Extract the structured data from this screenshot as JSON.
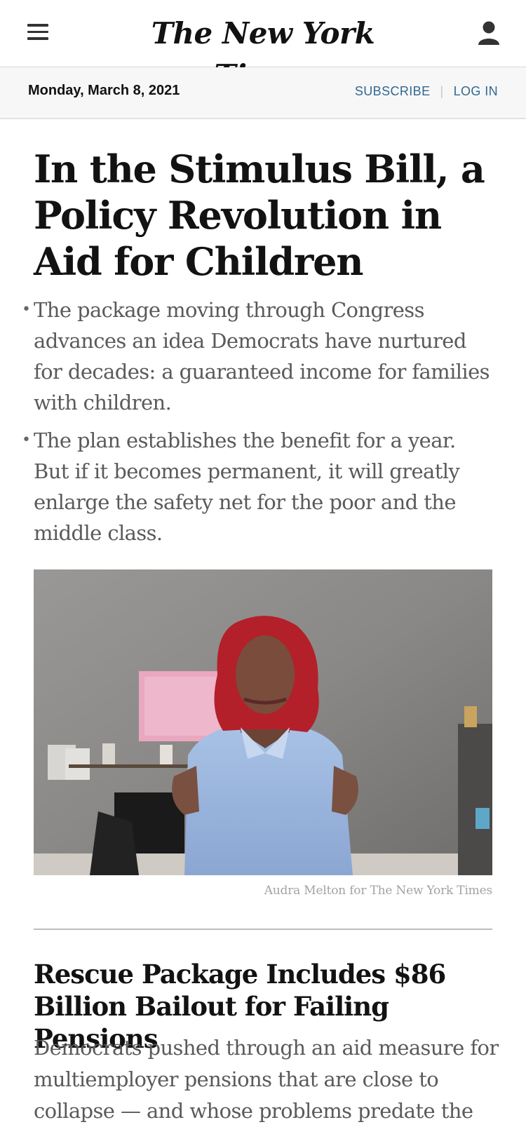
{
  "header": {
    "logo_text": "The New York Times",
    "menu_icon": "hamburger-menu-icon",
    "account_icon": "user-account-icon"
  },
  "datebar": {
    "date": "Monday, March 8, 2021",
    "subscribe_label": "SUBSCRIBE",
    "separator": "|",
    "login_label": "LOG IN"
  },
  "lead_story": {
    "headline": "In the Stimulus Bill, a Policy Revolution in Aid for Children",
    "bullets": [
      "The package moving through Congress advances an idea Democrats have nurtured for decades: a guaranteed income for families with children.",
      "The plan establishes the benefit for a year. But if it becomes permanent, it will greatly enlarge the safety net for the poor and the middle class."
    ],
    "photo_credit": "Audra Melton for The New York Times"
  },
  "second_story": {
    "headline": "Rescue Package Includes $86 Billion Bailout for Failing Pensions",
    "summary": "Democrats pushed through an aid measure for multiemployer pensions that are close to collapse — and whose problems predate the"
  },
  "colors": {
    "link": "#326891",
    "text": "#121212",
    "summary": "#5a5a5a",
    "datebar_bg": "#f7f7f7"
  }
}
